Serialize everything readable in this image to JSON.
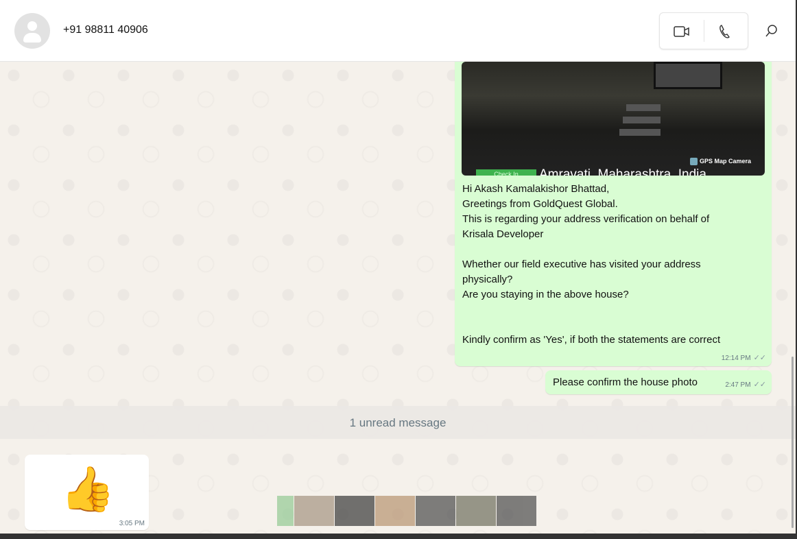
{
  "header": {
    "contact": "+91 98811 40906",
    "icons": [
      "avatar-icon",
      "video-call-icon",
      "voice-call-icon",
      "search-icon"
    ]
  },
  "messages": [
    {
      "image": {
        "badge": "Check In",
        "location": "Amravati, Maharashtra, India",
        "watermark": "GPS Map Camera"
      },
      "text": "Hi Akash Kamalakishor Bhattad,\nGreetings from GoldQuest Global.\nThis is regarding your address verification on behalf of\nKrisala Developer\n\nWhether our field executive has visited your address\nphysically?\nAre you staying in the above house?\n\n\nKindly confirm as 'Yes', if both the statements are correct",
      "time": "12:14 PM",
      "status": "✓✓"
    },
    {
      "text": "Please confirm the house photo",
      "time": "2:47 PM",
      "status": "✓✓"
    }
  ],
  "unread": "1 unread message",
  "incoming": {
    "emoji": "👍",
    "time": "3:05 PM"
  },
  "colors": {
    "outgoing": "#d9fdd3",
    "incoming": "#ffffff",
    "background": "#f5f1eb"
  }
}
